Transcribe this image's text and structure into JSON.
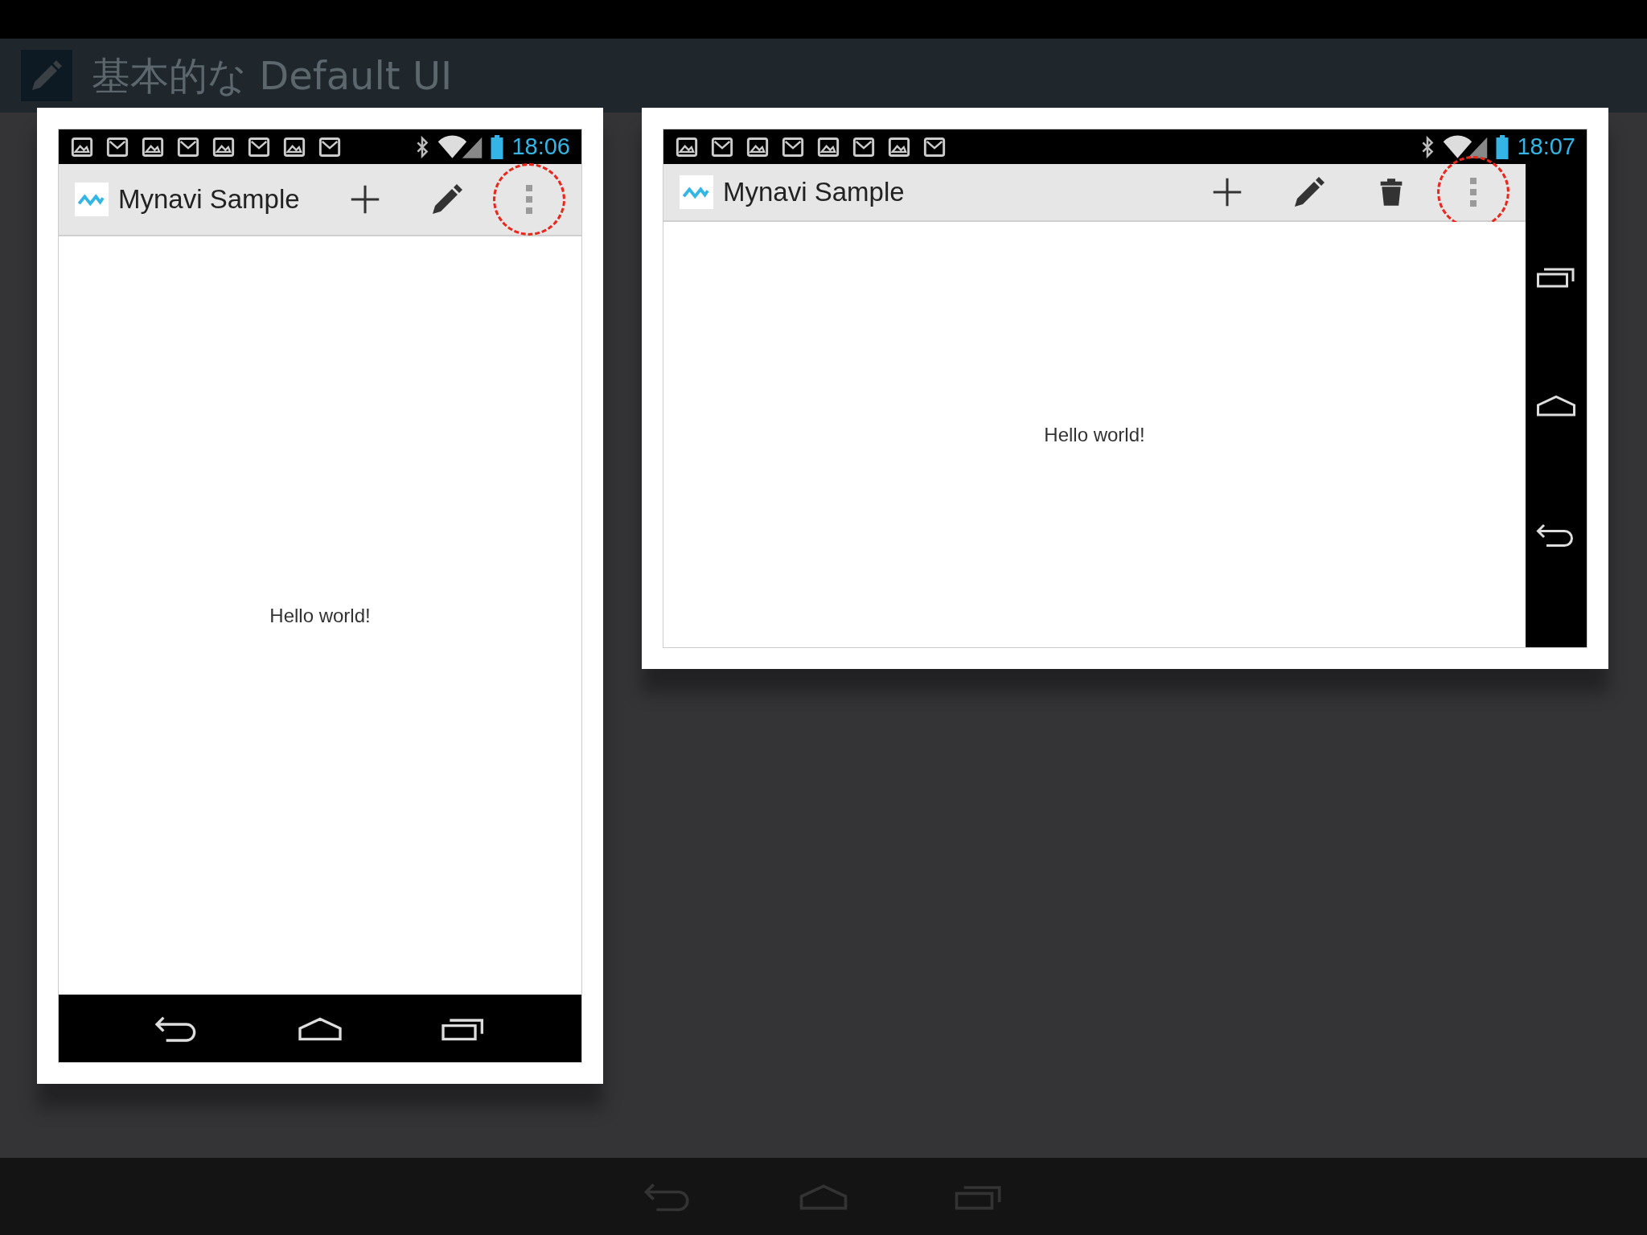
{
  "slide": {
    "title": "基本的な Default UI"
  },
  "screenshots": [
    {
      "kind": "portrait",
      "status_time": "18:06",
      "app_title": "Mynavi Sample",
      "actions": [
        {
          "kind": "add",
          "highlighted": false
        },
        {
          "kind": "edit",
          "highlighted": false
        },
        {
          "kind": "overflow",
          "highlighted": true
        }
      ],
      "content_text": "Hello world!"
    },
    {
      "kind": "landscape",
      "status_time": "18:07",
      "app_title": "Mynavi Sample",
      "actions": [
        {
          "kind": "add",
          "highlighted": false
        },
        {
          "kind": "edit",
          "highlighted": false
        },
        {
          "kind": "delete",
          "highlighted": false
        },
        {
          "kind": "overflow",
          "highlighted": true
        }
      ],
      "content_text": "Hello world!"
    }
  ]
}
